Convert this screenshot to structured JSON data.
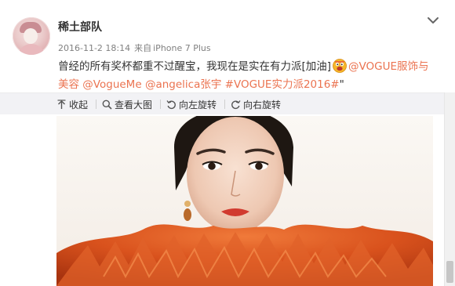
{
  "post": {
    "username": "稀土部队",
    "date": "2016-11-2 18:14",
    "source_prefix": "来自",
    "device": "iPhone 7 Plus",
    "text_main": "曾经的所有奖杯都重不过醒宝，我现在是实在有力派[加油]",
    "mention_1": "@VOGUE服饰与",
    "line2_mention_1": "美容",
    "mention_2": "@VogueMe",
    "mention_3": "@angelica张宇",
    "hashtag": "#VOGUE实力派2016#",
    "trailing": "\""
  },
  "toolbar": {
    "collapse_label": "收起",
    "view_large_label": "查看大图",
    "rotate_left_label": "向左旋转",
    "rotate_right_label": "向右旋转"
  },
  "icons": {
    "collapse": "collapse-up-arrow-icon",
    "view_large": "magnifier-icon",
    "rotate_left": "rotate-left-icon",
    "rotate_right": "rotate-right-icon",
    "menu": "chevron-down-icon",
    "emoji": "jiayou-emoji-icon"
  },
  "colors": {
    "link": "#eb7350",
    "toolbar_bg": "#f2f2f5",
    "meta_text": "#808080"
  }
}
